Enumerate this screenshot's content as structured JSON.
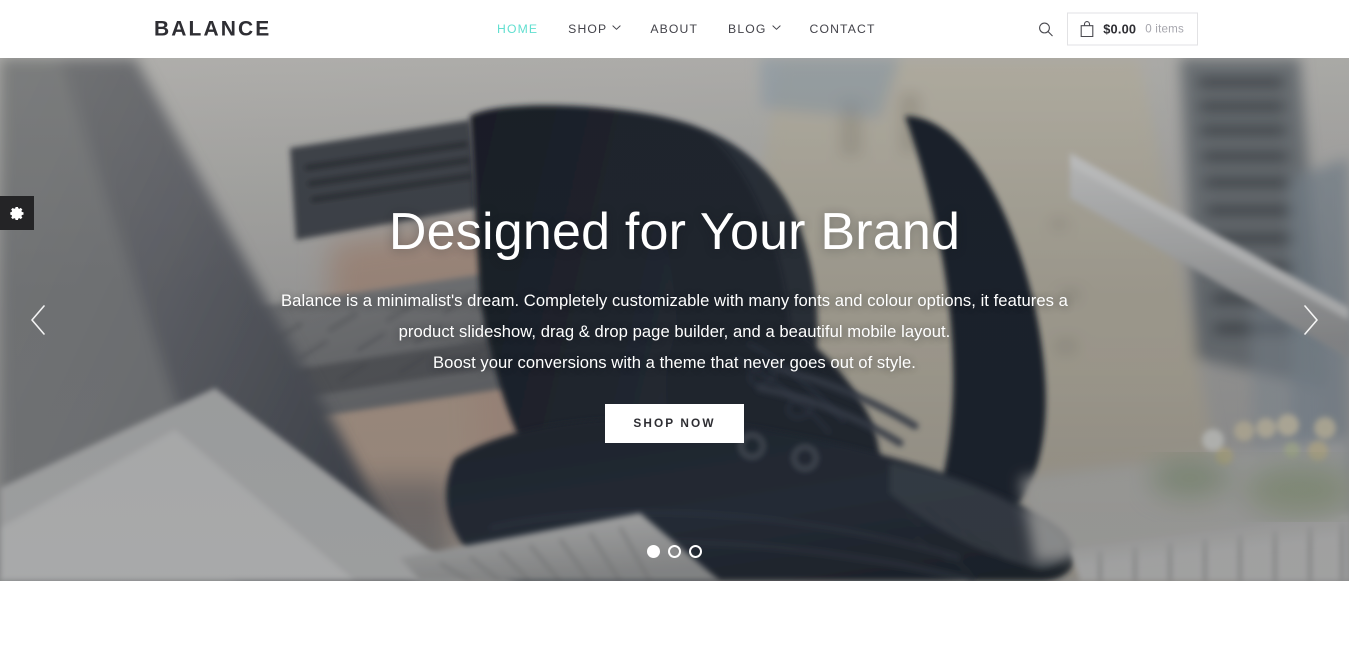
{
  "header": {
    "brand": "BALANCE",
    "nav": [
      {
        "label": "HOME",
        "active": true,
        "caret": false,
        "name": "nav-home"
      },
      {
        "label": "SHOP",
        "active": false,
        "caret": true,
        "name": "nav-shop"
      },
      {
        "label": "ABOUT",
        "active": false,
        "caret": false,
        "name": "nav-about"
      },
      {
        "label": "BLOG",
        "active": false,
        "caret": true,
        "name": "nav-blog"
      },
      {
        "label": "CONTACT",
        "active": false,
        "caret": false,
        "name": "nav-contact"
      }
    ],
    "search_icon": "search-icon",
    "cart": {
      "icon": "shopping-bag-icon",
      "total": "$0.00",
      "count": "0 items"
    },
    "accent_color": "#62dfd0",
    "text_color": "#43434a"
  },
  "hero": {
    "title": "Designed for Your Brand",
    "paragraph_lines": [
      "Balance is a minimalist's dream. Completely customizable with many fonts and colour options, it features a",
      "product slideshow, drag & drop page builder, and a beautiful mobile layout.",
      "Boost your conversions with a theme that never goes out of style."
    ],
    "cta_label": "SHOP NOW",
    "prev_icon": "chevron-left-icon",
    "next_icon": "chevron-right-icon",
    "slides": {
      "total": 3,
      "active_index": 0
    },
    "image_description": "Close-up photo of a person's legs in dark jeans and black platform sneakers standing on a metal grated stairway with blurred city buildings behind",
    "overlay_color": "#262b34"
  },
  "settings_tab": {
    "icon": "gear-icon",
    "background": "#242426"
  }
}
